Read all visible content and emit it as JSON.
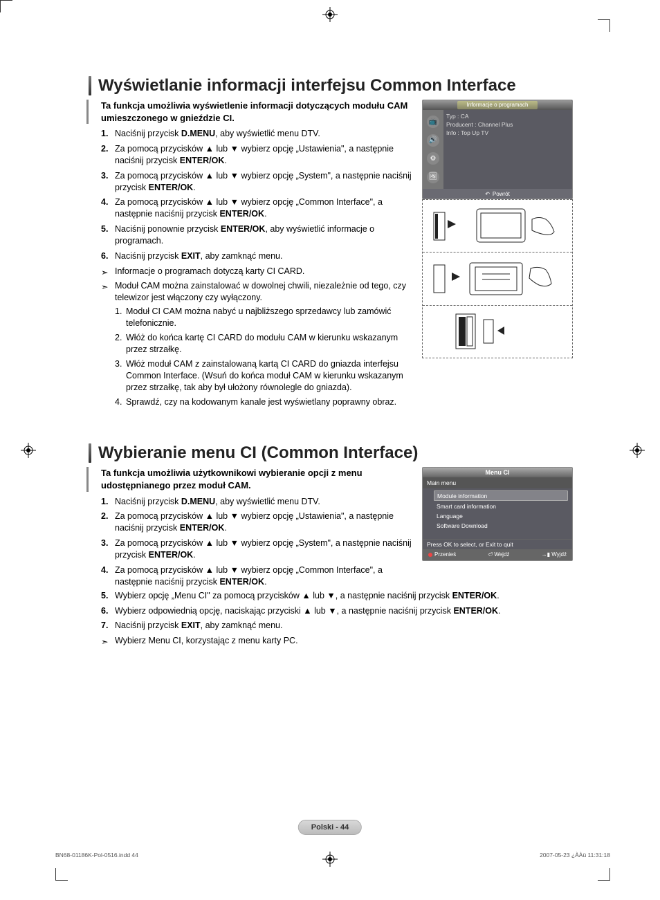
{
  "section1": {
    "title": "Wyświetlanie informacji interfejsu Common Interface",
    "intro": "Ta funkcja umożliwia wyświetlenie informacji dotyczących modułu CAM umieszczonego w gnieździe CI.",
    "steps": [
      {
        "n": "1.",
        "pre": "Naciśnij przycisk ",
        "bold": "D.MENU",
        "post": ", aby wyświetlić menu DTV."
      },
      {
        "n": "2.",
        "pre": "Za pomocą przycisków ▲ lub ▼ wybierz opcję „Ustawienia\", a następnie naciśnij przycisk ",
        "bold": "ENTER/OK",
        "post": "."
      },
      {
        "n": "3.",
        "pre": "Za pomocą przycisków ▲ lub ▼ wybierz opcję „System\", a następnie naciśnij przycisk ",
        "bold": "ENTER/OK",
        "post": "."
      },
      {
        "n": "4.",
        "pre": "Za pomocą przycisków ▲ lub ▼ wybierz opcję „Common Interface\", a następnie naciśnij przycisk ",
        "bold": "ENTER/OK",
        "post": "."
      },
      {
        "n": "5.",
        "pre": "Naciśnij ponownie przycisk ",
        "bold": "ENTER/OK",
        "post": ", aby wyświetlić informacje o programach."
      },
      {
        "n": "6.",
        "pre": "Naciśnij przycisk ",
        "bold": "EXIT",
        "post": ", aby zamknąć menu."
      }
    ],
    "note1": "Informacje o programach dotyczą karty CI CARD.",
    "note2": "Moduł CAM można zainstalować w dowolnej chwili, niezależnie od tego, czy telewizor jest włączony czy wyłączony.",
    "sub": [
      {
        "n": "1.",
        "t": "Moduł CI CAM można nabyć u najbliższego sprzedawcy lub zamówić telefonicznie."
      },
      {
        "n": "2.",
        "t": "Włóż do końca kartę CI CARD do modułu CAM w kierunku wskazanym przez strzałkę."
      },
      {
        "n": "3.",
        "t": "Włóż moduł CAM z zainstalowaną kartą CI CARD do gniazda interfejsu Common Interface. (Wsuń do końca moduł CAM w kierunku wskazanym przez strzałkę, tak aby był ułożony równolegle do gniazda)."
      },
      {
        "n": "4.",
        "t": "Sprawdź, czy na kodowanym kanale jest wyświetlany poprawny obraz."
      }
    ],
    "osd": {
      "title": "Informacje o programach",
      "line1": "Typ : CA",
      "line2": "Producent : Channel Plus",
      "line3": "Info : Top Up TV",
      "back": "Powrót"
    }
  },
  "section2": {
    "title": "Wybieranie menu CI (Common Interface)",
    "intro": "Ta funkcja umożliwia użytkownikowi wybieranie opcji z menu udostępnianego przez moduł CAM.",
    "steps": [
      {
        "n": "1.",
        "pre": "Naciśnij przycisk ",
        "bold": "D.MENU",
        "post": ", aby wyświetlić menu DTV."
      },
      {
        "n": "2.",
        "pre": "Za pomocą przycisków ▲ lub ▼ wybierz opcję „Ustawienia\", a następnie naciśnij przycisk ",
        "bold": "ENTER/OK",
        "post": "."
      },
      {
        "n": "3.",
        "pre": "Za pomocą przycisków ▲ lub ▼ wybierz opcję „System\", a następnie naciśnij przycisk ",
        "bold": "ENTER/OK",
        "post": "."
      },
      {
        "n": "4.",
        "pre": "Za pomocą przycisków ▲ lub ▼ wybierz opcję „Common Interface\", a następnie naciśnij przycisk ",
        "bold": "ENTER/OK",
        "post": "."
      },
      {
        "n": "5.",
        "pre": "Wybierz opcję „Menu CI\" za pomocą przycisków ▲ lub ▼, a następnie naciśnij przycisk ",
        "bold": "ENTER/OK",
        "post": "."
      },
      {
        "n": "6.",
        "pre": "Wybierz odpowiednią opcję, naciskając przyciski ▲ lub ▼, a następnie naciśnij przycisk ",
        "bold": "ENTER/OK",
        "post": "."
      },
      {
        "n": "7.",
        "pre": "Naciśnij przycisk ",
        "bold": "EXIT",
        "post": ", aby zamknąć menu."
      }
    ],
    "note1": "Wybierz Menu CI, korzystając z menu karty PC.",
    "osd": {
      "title": "Menu CI",
      "sub": "Main menu",
      "items": [
        "Module information",
        "Smart card information",
        "Language",
        "Software Download"
      ],
      "prompt": "Press OK to select, or Exit to quit",
      "foot": {
        "move": "Przenieś",
        "enter": "Wejdź",
        "exit": "Wyjdź"
      }
    }
  },
  "pageLabel": "Polski - 44",
  "footer": {
    "left": "BN68-01186K-Pol-0516.indd   44",
    "right": "2007-05-23   ¿ÀÀü 11:31:18"
  }
}
